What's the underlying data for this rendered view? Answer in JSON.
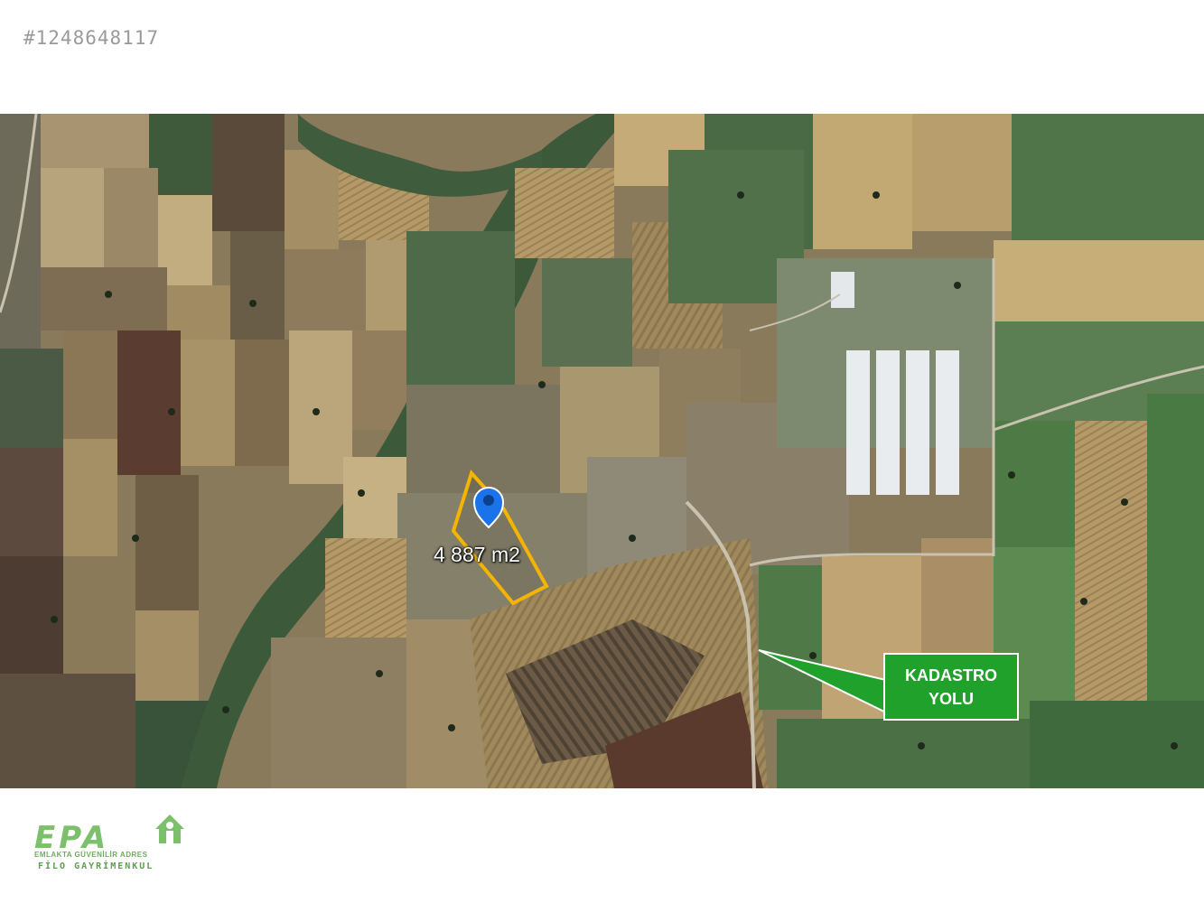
{
  "listing": {
    "id": "#1248648117"
  },
  "map": {
    "view": "satellite",
    "parcel": {
      "area_label": "4 887 m2",
      "outline_color": "#f5b400",
      "pin_color": "#1a73e8"
    },
    "callout": {
      "line1": "KADASTRO",
      "line2": "YOLU",
      "color": "#1fa12c"
    }
  },
  "logo": {
    "word": "EPA",
    "tagline": "EMLAKTA GÜVENİLİR ADRES",
    "company": "FİLO GAYRİMENKUL",
    "color": "#7cc06b",
    "icon": "house-icon"
  }
}
